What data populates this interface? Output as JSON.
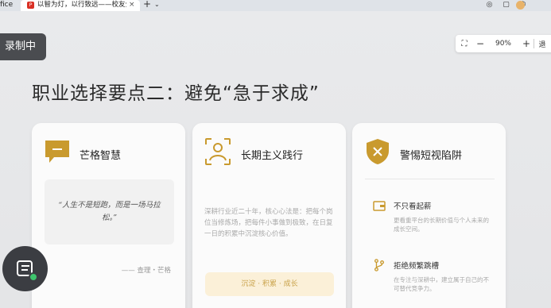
{
  "browser": {
    "left_tab_fragment": "fice",
    "active_tab_title": "以智为灯，以行致远——校友分享",
    "new_tab": "+",
    "tab_menu": "⌄",
    "close": "×"
  },
  "toolbar": {
    "record_label": "录制中",
    "zoom_value": "90%",
    "zoom_minus": "−",
    "zoom_plus": "+",
    "more_fragment": "退"
  },
  "slide": {
    "title": "职业选择要点二：避免“急于求成”",
    "cards": [
      {
        "title": "芒格智慧",
        "icon": "chat-bubble-icon",
        "quote": "“人生不是短跑，而是一场马拉松。”",
        "author": "—— 查理・芒格"
      },
      {
        "title": "长期主义践行",
        "icon": "person-focus-icon",
        "description": "深耕行业近二十年，核心心法是：把每个岗位当修炼场，把每件小事做到极致，在日复一日的积累中沉淀核心价值。",
        "banner": "沉淀 · 积累 · 成长"
      },
      {
        "title": "警惕短视陷阱",
        "icon": "shield-x-icon",
        "items": [
          {
            "title": "不只看起薪",
            "icon": "wallet-icon",
            "description": "更看重平台的长期价值与个人未来的成长空间。"
          },
          {
            "title": "拒绝频繁跳槽",
            "icon": "branch-icon",
            "description": "在专注与深耕中，建立属于自己的不可替代竞争力。"
          }
        ]
      }
    ]
  },
  "colors": {
    "accent_gold": "#c99a2e",
    "banner_bg": "#fbf0d8",
    "record_bg": "#4a4c50"
  }
}
